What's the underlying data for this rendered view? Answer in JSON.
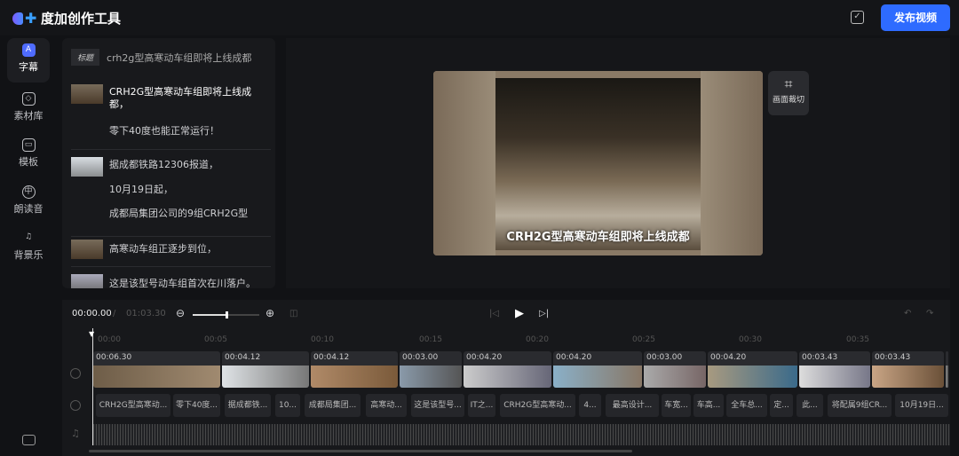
{
  "header": {
    "app_title": "度加创作工具",
    "publish_label": "发布视频"
  },
  "sidebar": {
    "items": [
      {
        "label": "字幕",
        "icon": "A"
      },
      {
        "label": "素材库",
        "icon": "◇"
      },
      {
        "label": "模板",
        "icon": "▭"
      },
      {
        "label": "朗读音",
        "icon": "中"
      },
      {
        "label": "背景乐",
        "icon": "♫"
      }
    ]
  },
  "subtitles": {
    "title_tag": "标题",
    "title_text": "crh2g型高寒动车组即将上线成都",
    "groups": [
      {
        "lines": [
          "CRH2G型高寒动车组即将上线成都，",
          "零下40度也能正常运行！"
        ]
      },
      {
        "lines": [
          "据成都铁路12306报道，",
          "10月19日起，",
          "成都局集团公司的9组CRH2G型"
        ]
      },
      {
        "lines": [
          "高寒动车组正逐步到位，"
        ]
      },
      {
        "lines": [
          "这是该型号动车组首次在川落户。"
        ]
      }
    ]
  },
  "preview": {
    "caption": "CRH2G型高寒动车组即将上线成都",
    "crop_label": "画面裁切"
  },
  "timeline": {
    "current_time": "00:00.00",
    "separator": "/",
    "total_time": "01:03.30",
    "zoom_fraction": 0.5,
    "ruler": [
      "00:00",
      "00:05",
      "00:10",
      "00:15",
      "00:20",
      "00:25",
      "00:30",
      "00:35"
    ],
    "clips": [
      "00:06.30",
      "00:04.12",
      "00:04.12",
      "00:03.00",
      "00:04.20",
      "00:04.20",
      "00:03.00",
      "00:04.20",
      "00:03.43",
      "00:03.43",
      ""
    ],
    "subtitle_chunks": [
      "CRH2G型高寒动...",
      "零下40度...",
      "据成都铁...",
      "10...",
      "成都局集团...",
      "高寒动...",
      "这是该型号...",
      "IT之...",
      "CRH2G型高寒动...",
      "4...",
      "最高设计...",
      "车宽...",
      "车高...",
      "全车总...",
      "定...",
      "此...",
      "将配属9组CR...",
      "10月19日..."
    ]
  }
}
